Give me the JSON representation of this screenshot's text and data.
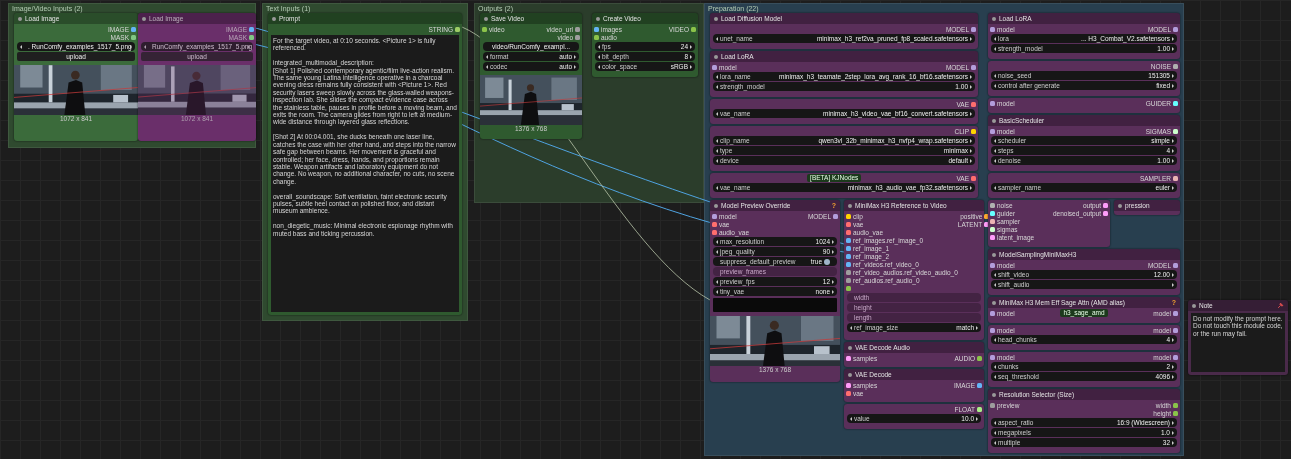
{
  "groups": [
    {
      "title": "Image/Video Inputs (2)",
      "color": "#2f4a2f"
    },
    {
      "title": "Text Inputs (1)",
      "color": "#2f4a2f"
    },
    {
      "title": "Outputs (2)",
      "color": "#2b3d2b"
    },
    {
      "title": "Preparation (22)",
      "color": "#283f4f"
    }
  ],
  "nodes": [
    {
      "title": "Load Image",
      "color": "#3b6b3b",
      "bypassed": false,
      "outputs": [
        {
          "label": "IMAGE",
          "color": "#64b5f6"
        },
        {
          "label": "MASK",
          "color": "#81c784"
        }
      ],
      "widgets": [
        {
          "kind": "value",
          "value": ". RunComfy_examples_1517_5.png"
        },
        {
          "kind": "button",
          "label": "upload"
        }
      ],
      "preview": {
        "caption": "1072 x 841"
      }
    },
    {
      "title": "Load Image",
      "color": "#6a2f6a",
      "bypassed": true,
      "outputs": [
        {
          "label": "IMAGE",
          "color": "#64b5f6"
        },
        {
          "label": "MASK",
          "color": "#81c784"
        }
      ],
      "widgets": [
        {
          "kind": "value",
          "value": "RunComfy_examples_1517_5.png"
        },
        {
          "kind": "button",
          "label": "upload"
        }
      ],
      "preview": {
        "caption": "1072 x 841"
      }
    },
    {
      "title": "Prompt",
      "color": "#2f5a2f",
      "bypassed": false,
      "outputs": [
        {
          "label": "STRING",
          "color": "#9ccc65"
        }
      ],
      "text": "For the target video, at 0:10 seconds. <Picture 1> is fully referenced.\n\nintegrated_multimodal_description:\n[Shot 1] Polished contemporary agentic/film live-action realism. The same young Latina intelligence operative in a charcoal evening dress remains fully consistent with <Picture 1>. Red security lasers sweep slowly across the glass-walled weapons-inspection lab. She slides the compact evidence case across the stainless table, pauses in profile before a moving beam, and exits the room. The camera glides from right to left at medium-wide distance through layered glass reflections.\n\n[Shot 2] At 00:04.001, she ducks beneath one laser line, catches the case with her other hand, and steps into the narrow safe gap between beams. Her movement is graceful and controlled; her face, dress, hands, and proportions remain stable. Weapon artifacts and laboratory equipment do not change. No weapon, no additional character, no cuts, no scene change.\n\noverall_soundscape: Soft ventilation, faint electronic security pulses, subtle heel contact on polished floor, and distant museum ambience.\n\nnon_diegetic_music: Minimal electronic espionage rhythm with muted bass and ticking percussion."
    },
    {
      "title": "Save Video",
      "color": "#2f5a2f",
      "bypassed": false,
      "inputs": [
        {
          "label": "video",
          "color": "#8bc34a"
        }
      ],
      "outputs": [
        {
          "label": "video_url",
          "color": "#9e9e9e"
        },
        {
          "label": "video",
          "color": "#9e9e9e"
        }
      ],
      "widgets": [
        {
          "kind": "text",
          "value": "video/RunComfy_exampl..."
        },
        {
          "kind": "value",
          "label": "format",
          "value": "auto"
        },
        {
          "kind": "value",
          "label": "codec",
          "value": "auto"
        }
      ],
      "preview": {
        "caption": "1376 x 768"
      }
    },
    {
      "title": "Create Video",
      "color": "#2f5a2f",
      "bypassed": false,
      "inputs": [
        {
          "label": "images",
          "color": "#64b5f6"
        },
        {
          "label": "audio",
          "color": "#8bc34a"
        }
      ],
      "outputs": [
        {
          "label": "VIDEO",
          "color": "#8bc34a"
        }
      ],
      "widgets": [
        {
          "kind": "value",
          "label": "fps",
          "value": "24"
        },
        {
          "kind": "value",
          "label": "bit_depth",
          "value": "8"
        },
        {
          "kind": "value",
          "label": "color_space",
          "value": "sRGB"
        }
      ]
    },
    {
      "title": "Load Diffusion Model",
      "color": "#5a2f5a",
      "bypassed": false,
      "outputs": [
        {
          "label": "MODEL",
          "color": "#b39ddb"
        }
      ],
      "widgets": [
        {
          "kind": "value",
          "label": "unet_name",
          "value": "minimax_h3_ref2va_pruned_fp8_scaled.safetensors"
        }
      ]
    },
    {
      "title": "Load LoRA",
      "color": "#5a2f5a",
      "bypassed": false,
      "inputs": [
        {
          "label": "model",
          "color": "#b39ddb"
        }
      ],
      "outputs": [
        {
          "label": "MODEL",
          "color": "#b39ddb"
        }
      ],
      "widgets": [
        {
          "kind": "value",
          "label": "lora_name",
          "value": "minimax_h3_teamate_2step_lora_avg_rank_16_bf16.safetensors"
        },
        {
          "kind": "value",
          "label": "strength_model",
          "value": "1.00"
        }
      ]
    },
    {
      "color": "#5a2f5a",
      "bypassed": false,
      "outputs": [
        {
          "label": "VAE",
          "color": "#ff6e6e"
        }
      ],
      "widgets": [
        {
          "kind": "value",
          "label": "vae_name",
          "value": "minimax_h3_video_vae_bf16_convert.safetensors"
        }
      ]
    },
    {
      "color": "#5a2f5a",
      "bypassed": false,
      "outputs": [
        {
          "label": "CLIP",
          "color": "#ffd500"
        }
      ],
      "widgets": [
        {
          "kind": "value",
          "label": "clip_name",
          "value": "qwen3vl_32b_minimax_h3_nvfp4_wrap.safetensors"
        },
        {
          "kind": "value",
          "label": "type",
          "value": "minimax"
        },
        {
          "kind": "value",
          "label": "device",
          "value": "default"
        }
      ]
    },
    {
      "color": "#5a2f5a",
      "bypassed": false,
      "badge": "[BETA] KJNodes",
      "outputs": [
        {
          "label": "VAE",
          "color": "#ff6e6e"
        }
      ],
      "widgets": [
        {
          "kind": "value",
          "label": "vae_name",
          "value": "minimax_h3_audio_vae_fp32.safetensors"
        }
      ]
    },
    {
      "title": "Model Preview Override",
      "help": "?",
      "color": "#5a2f5a",
      "bypassed": false,
      "inputs": [
        {
          "label": "model",
          "color": "#b39ddb"
        },
        {
          "label": "vae",
          "color": "#ff6e6e"
        },
        {
          "label": "audio_vae",
          "color": "#ff6e6e"
        }
      ],
      "outputs": [
        {
          "label": "MODEL",
          "color": "#b39ddb"
        }
      ],
      "widgets": [
        {
          "kind": "value",
          "label": "max_resolution",
          "value": "1024"
        },
        {
          "kind": "value",
          "label": "jpeg_quality",
          "value": "90"
        },
        {
          "kind": "toggle",
          "label": "suppress_default_preview",
          "value": "true",
          "on": true
        },
        {
          "kind": "slot",
          "label": "preview_frames"
        },
        {
          "kind": "value",
          "label": "preview_fps",
          "value": "12"
        },
        {
          "kind": "value",
          "label": "tiny_vae",
          "value": "none"
        },
        {
          "kind": "blank"
        }
      ],
      "preview": {
        "caption": "1376 x 768"
      }
    },
    {
      "title": "MiniMax H3 Reference to Video",
      "color": "#5a2f5a",
      "bypassed": false,
      "inputs": [
        {
          "label": "clip",
          "color": "#ffd500"
        },
        {
          "label": "vae",
          "color": "#ff6e6e"
        },
        {
          "label": "audio_vae",
          "color": "#ff6e6e"
        },
        {
          "label": "ref_images.ref_image_0",
          "color": "#64b5f6"
        },
        {
          "label": "ref_image_1",
          "color": "#64b5f6"
        },
        {
          "label": "ref_image_2",
          "color": "#64b5f6"
        },
        {
          "label": "ref_videos.ref_video_0",
          "color": "#64b5f6"
        },
        {
          "label": "ref_video_audios.ref_video_audio_0",
          "color": "#9e9e9e"
        },
        {
          "label": "ref_audios.ref_audio_0",
          "color": "#9e9e9e"
        },
        {
          "color": "#8bc34a"
        }
      ],
      "outputs": [
        {
          "label": "positive",
          "color": "#ffa931"
        },
        {
          "label": "LATENT",
          "color": "#ff9cf9"
        }
      ],
      "widgets": [
        {
          "kind": "slot",
          "label": "width"
        },
        {
          "kind": "slot",
          "label": "height"
        },
        {
          "kind": "slot",
          "label": "length"
        },
        {
          "kind": "value",
          "label": "ref_image_size",
          "value": "match"
        }
      ]
    },
    {
      "title": "VAE Decode Audio",
      "color": "#5a2f5a",
      "bypassed": false,
      "inputs": [
        {
          "label": "samples",
          "color": "#ff9cf9"
        }
      ],
      "outputs": [
        {
          "label": "AUDIO",
          "color": "#8bc34a"
        }
      ]
    },
    {
      "title": "VAE Decode",
      "color": "#5a2f5a",
      "bypassed": false,
      "inputs": [
        {
          "label": "samples",
          "color": "#ff9cf9"
        },
        {
          "label": "vae",
          "color": "#ff6e6e"
        }
      ],
      "outputs": [
        {
          "label": "IMAGE",
          "color": "#64b5f6"
        }
      ]
    },
    {
      "color": "#5a2f5a",
      "bypassed": false,
      "outputs": [
        {
          "label": "FLOAT",
          "color": "#aaee88"
        }
      ],
      "widgets": [
        {
          "kind": "value",
          "label": "value",
          "value": "10.0"
        }
      ]
    },
    {
      "title": "Load LoRA",
      "color": "#5a2f5a",
      "bypassed": false,
      "inputs": [
        {
          "label": "model",
          "color": "#b39ddb"
        }
      ],
      "outputs": [
        {
          "label": "MODEL",
          "color": "#b39ddb"
        }
      ],
      "widgets": [
        {
          "kind": "value",
          "label": "lora",
          "value": "... H3_Combat_V2.safetensors"
        },
        {
          "kind": "value",
          "label": "strength_model",
          "value": "1.00"
        }
      ]
    },
    {
      "color": "#5a2f5a",
      "bypassed": false,
      "outputs": [
        {
          "label": "NOISE",
          "color": "#b0b0b0"
        }
      ],
      "widgets": [
        {
          "kind": "value",
          "label": "noise_seed",
          "value": "151305"
        },
        {
          "kind": "value",
          "label": "control after generate",
          "value": "fixed"
        }
      ]
    },
    {
      "color": "#5a2f5a",
      "bypassed": false,
      "inputs": [
        {
          "label": "model",
          "color": "#b39ddb"
        }
      ],
      "outputs": [
        {
          "label": "GUIDER",
          "color": "#66ffff"
        }
      ]
    },
    {
      "title": "BasicScheduler",
      "color": "#5a2f5a",
      "bypassed": false,
      "inputs": [
        {
          "label": "model",
          "color": "#b39ddb"
        }
      ],
      "outputs": [
        {
          "label": "SIGMAS",
          "color": "#cdffcd"
        }
      ],
      "widgets": [
        {
          "kind": "value",
          "label": "scheduler",
          "value": "simple"
        },
        {
          "kind": "value",
          "label": "steps",
          "value": "4"
        },
        {
          "kind": "value",
          "label": "denoise",
          "value": "1.00"
        }
      ]
    },
    {
      "color": "#5a2f5a",
      "bypassed": false,
      "outputs": [
        {
          "label": "SAMPLER",
          "color": "#ecb4b4"
        }
      ],
      "widgets": [
        {
          "kind": "value",
          "label": "sampler_name",
          "value": "euler"
        }
      ]
    },
    {
      "color": "#5a2f5a",
      "bypassed": false,
      "inputs": [
        {
          "label": "noise",
          "color": "#b0b0b0"
        },
        {
          "label": "guider",
          "color": "#66ffff"
        },
        {
          "label": "sampler",
          "color": "#ecb4b4"
        },
        {
          "label": "sigmas",
          "color": "#cdffcd"
        },
        {
          "label": "latent_image",
          "color": "#ff9cf9"
        }
      ],
      "outputs": [
        {
          "label": "output",
          "color": "#ff9cf9"
        },
        {
          "label": "denoised_output",
          "color": "#ff9cf9"
        }
      ]
    },
    {
      "title": "pression",
      "color": "#5a2f5a",
      "bypassed": false
    },
    {
      "title": "ModelSamplingMiniMaxH3",
      "color": "#5a2f5a",
      "bypassed": false,
      "inputs": [
        {
          "label": "model",
          "color": "#b39ddb"
        }
      ],
      "outputs": [
        {
          "label": "MODEL",
          "color": "#b39ddb"
        }
      ],
      "widgets": [
        {
          "kind": "value",
          "label": "shift_video",
          "value": "12.00"
        },
        {
          "kind": "value",
          "label": "shift_audio"
        }
      ]
    },
    {
      "title": "MiniMax H3 Mem Eff Sage Attn (AMD alias)",
      "help": "?",
      "badge": "h3_sage_amd",
      "color": "#5a2f5a",
      "bypassed": false,
      "inputs": [
        {
          "label": "model",
          "color": "#b39ddb"
        }
      ],
      "outputs": [
        {
          "label": "model",
          "color": "#b39ddb"
        }
      ]
    },
    {
      "color": "#5a2f5a",
      "bypassed": false,
      "inputs": [
        {
          "label": "model",
          "color": "#b39ddb"
        }
      ],
      "outputs": [
        {
          "label": "model",
          "color": "#b39ddb"
        }
      ],
      "widgets": [
        {
          "kind": "value",
          "label": "head_chunks",
          "value": "4"
        }
      ]
    },
    {
      "color": "#5a2f5a",
      "bypassed": false,
      "inputs": [
        {
          "label": "model",
          "color": "#b39ddb"
        }
      ],
      "outputs": [
        {
          "label": "model",
          "color": "#b39ddb"
        }
      ],
      "widgets": [
        {
          "kind": "value",
          "label": "chunks",
          "value": "2"
        },
        {
          "kind": "value",
          "label": "seq_threshold",
          "value": "4096"
        }
      ]
    },
    {
      "title": "Resolution Selector (Size)",
      "color": "#5a2f5a",
      "bypassed": false,
      "inputs": [
        {
          "label": "preview",
          "color": "#9e9e9e"
        }
      ],
      "outputs": [
        {
          "label": "width",
          "color": "#8bc34a"
        },
        {
          "label": "height",
          "color": "#8bc34a"
        }
      ],
      "widgets": [
        {
          "kind": "value",
          "label": "aspect_ratio",
          "value": "16:9 (Widescreen)"
        },
        {
          "kind": "value",
          "label": "megapixels",
          "value": "1.0"
        },
        {
          "kind": "value",
          "label": "multiple",
          "value": "32"
        }
      ]
    },
    {
      "title": "Note",
      "pinned": true,
      "color": "#4a2a4a",
      "bypassed": false,
      "text": "Do not modify the prompt here. Do not touch this module code, or the run may fail."
    }
  ]
}
